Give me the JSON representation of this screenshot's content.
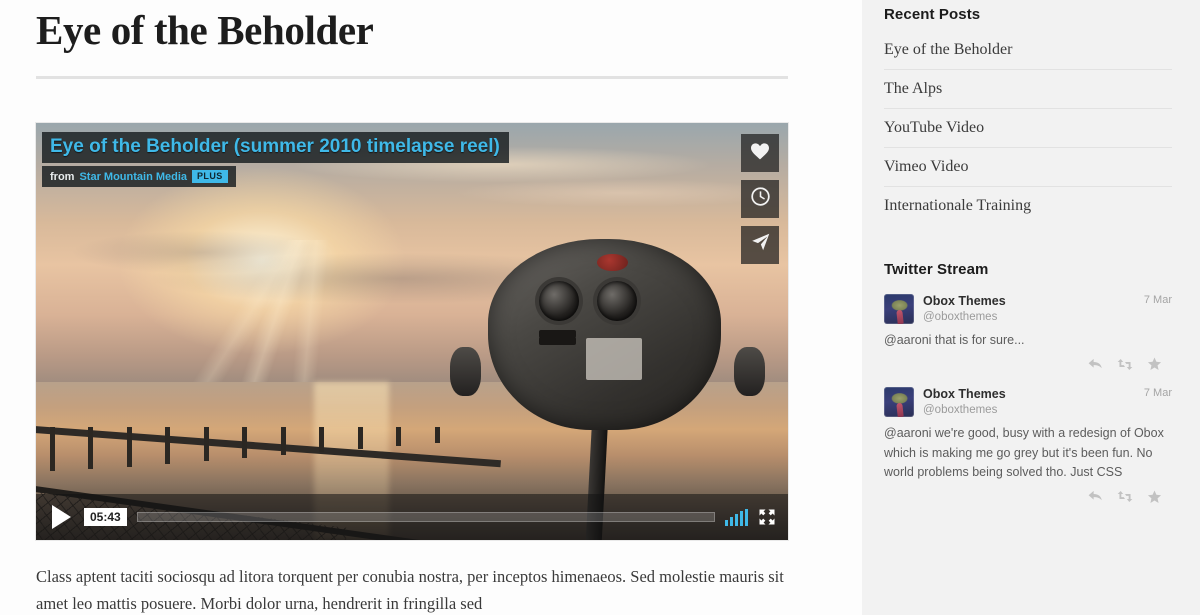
{
  "post": {
    "title": "Eye of the Beholder",
    "body_paragraph": "Class aptent taciti sociosqu ad litora torquent per conubia nostra, per inceptos himenaeos. Sed molestie mauris sit amet leo mattis posuere. Morbi dolor urna, hendrerit in fringilla sed"
  },
  "video": {
    "title": "Eye of the Beholder (summer 2010 timelapse reel)",
    "from_label": "from",
    "author": "Star Mountain Media",
    "plus_badge": "PLUS",
    "duration": "05:43",
    "actions": [
      {
        "name": "like-icon",
        "label": "Like"
      },
      {
        "name": "watch-later-icon",
        "label": "Watch Later"
      },
      {
        "name": "share-icon",
        "label": "Share"
      }
    ],
    "play_label": "Play",
    "volume_label": "Volume",
    "fullscreen_label": "Fullscreen",
    "accent_color": "#3fb9e8"
  },
  "sidebar": {
    "recent_posts": {
      "title": "Recent Posts",
      "items": [
        {
          "label": "Eye of the Beholder"
        },
        {
          "label": "The Alps"
        },
        {
          "label": "YouTube Video"
        },
        {
          "label": "Vimeo Video"
        },
        {
          "label": "Internationale Training"
        }
      ]
    },
    "twitter": {
      "title": "Twitter Stream",
      "tweets": [
        {
          "author": "Obox Themes",
          "handle": "@oboxthemes",
          "time": "7 Mar",
          "text": "@aaroni that is for sure...",
          "actions": [
            {
              "name": "reply-icon",
              "label": "Reply"
            },
            {
              "name": "retweet-icon",
              "label": "Retweet"
            },
            {
              "name": "favorite-icon",
              "label": "Favorite"
            }
          ]
        },
        {
          "author": "Obox Themes",
          "handle": "@oboxthemes",
          "time": "7 Mar",
          "text": "@aaroni we're good, busy with a redesign of Obox which is making me go grey but it's been fun. No world problems being solved tho. Just CSS",
          "actions": [
            {
              "name": "reply-icon",
              "label": "Reply"
            },
            {
              "name": "retweet-icon",
              "label": "Retweet"
            },
            {
              "name": "favorite-icon",
              "label": "Favorite"
            }
          ]
        }
      ]
    }
  }
}
